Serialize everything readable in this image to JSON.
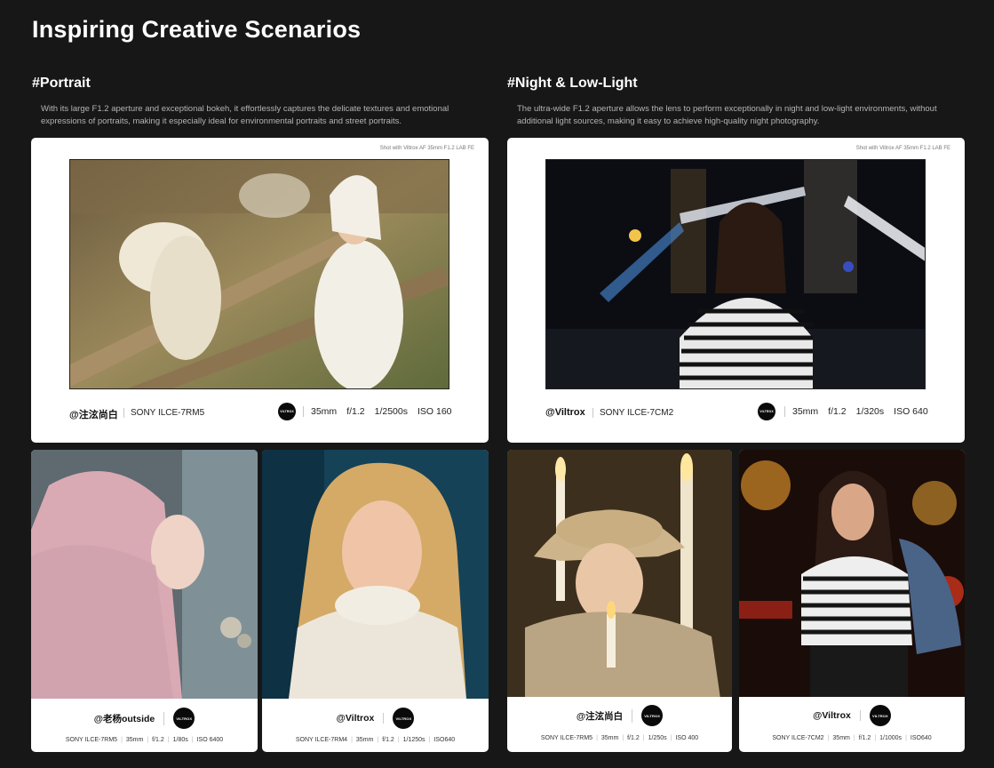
{
  "page": {
    "title": "Inspiring Creative Scenarios"
  },
  "sections": [
    {
      "heading": "#Portrait",
      "description": "With its large F1.2 aperture and exceptional bokeh, it effortlessly captures the delicate textures and emotional expressions of portraits, making it especially ideal for environmental portraits and street portraits.",
      "feature": {
        "shot_note": "Shot with Viltrox AF 35mm F1.2 LAB FE",
        "author": "@注泫尚白",
        "camera": "SONY ILCE-7RM5",
        "logo_text": "VILTROX",
        "exif": {
          "focal": "35mm",
          "aperture": "f/1.2",
          "shutter": "1/2500s",
          "iso": "ISO 160"
        }
      },
      "cards": [
        {
          "author": "@老杨outside",
          "logo_text": "VILTROX",
          "camera": "SONY ILCE-7RM5",
          "focal": "35mm",
          "aperture": "f/1.2",
          "shutter": "1/80s",
          "iso": "ISO 6400"
        },
        {
          "author": "@Viltrox",
          "logo_text": "VILTROX",
          "camera": "SONY ILCE-7RM4",
          "focal": "35mm",
          "aperture": "f/1.2",
          "shutter": "1/1250s",
          "iso": "ISO640"
        }
      ]
    },
    {
      "heading": "#Night & Low-Light",
      "description": "The ultra-wide F1.2 aperture allows the lens to perform exceptionally in night and low-light environments, without additional light sources, making it easy to achieve high-quality night photography.",
      "feature": {
        "shot_note": "Shot with Viltrox AF 35mm F1.2 LAB FE",
        "author": "@Viltrox",
        "camera": "SONY ILCE-7CM2",
        "logo_text": "VILTROX",
        "exif": {
          "focal": "35mm",
          "aperture": "f/1.2",
          "shutter": "1/320s",
          "iso": "ISO 640"
        }
      },
      "cards": [
        {
          "author": "@注泫尚白",
          "logo_text": "VILTROX",
          "camera": "SONY ILCE-7RM5",
          "focal": "35mm",
          "aperture": "f/1.2",
          "shutter": "1/250s",
          "iso": "ISO 400"
        },
        {
          "author": "@Viltrox",
          "logo_text": "VILTROX",
          "camera": "SONY ILCE-7CM2",
          "focal": "35mm",
          "aperture": "f/1.2",
          "shutter": "1/1000s",
          "iso": "ISO640"
        }
      ]
    }
  ]
}
